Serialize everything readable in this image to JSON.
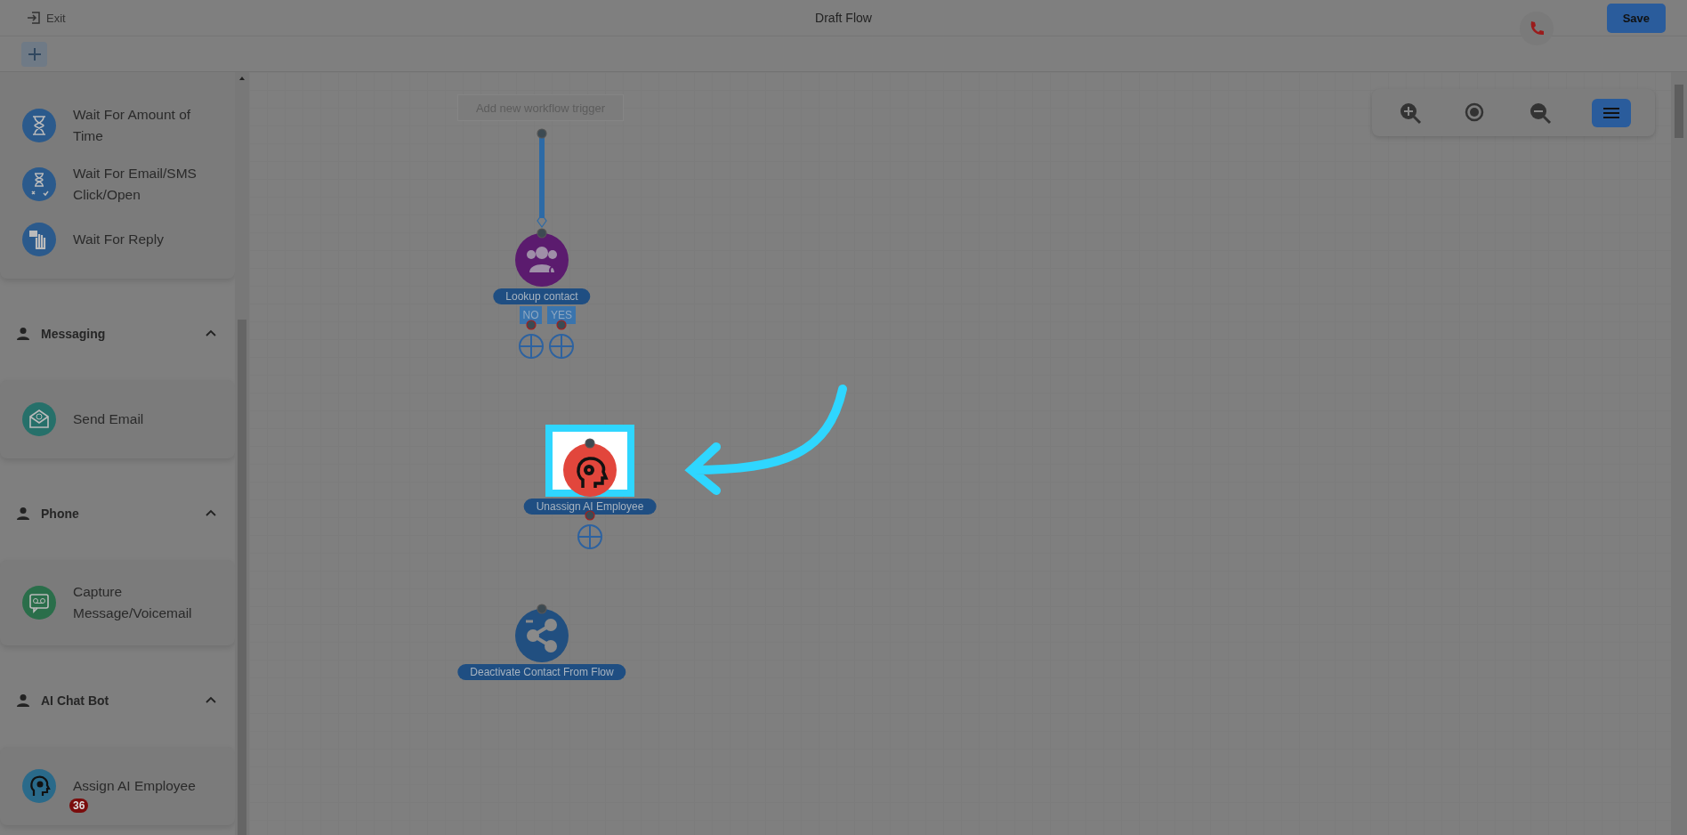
{
  "top_bar": {
    "exit_label": "Exit",
    "title": "Draft Flow",
    "save_button": "Save"
  },
  "sidebar": {
    "sections": [
      {
        "items": [
          {
            "label": "Wait For Amount of Time"
          },
          {
            "label": "Wait For Email/SMS Click/Open"
          },
          {
            "label": "Wait For Reply"
          }
        ]
      },
      {
        "title": "Messaging",
        "expanded": true,
        "items": [
          {
            "label": "Send Email"
          }
        ]
      },
      {
        "title": "Phone",
        "expanded": true,
        "items": [
          {
            "label": "Capture Message/Voicemail"
          }
        ]
      },
      {
        "title": "AI Chat Bot",
        "expanded": true,
        "items": [
          {
            "label": "Assign AI Employee",
            "badge": "36"
          }
        ]
      }
    ]
  },
  "canvas": {
    "trigger_placeholder": "Add new workflow trigger",
    "nodes": [
      {
        "label": "Lookup contact",
        "branches": [
          "NO",
          "YES"
        ],
        "highlighted": false
      },
      {
        "label": "Unassign AI Employee",
        "highlighted": true
      },
      {
        "label": "Deactivate Contact From Flow",
        "highlighted": false
      }
    ]
  }
}
